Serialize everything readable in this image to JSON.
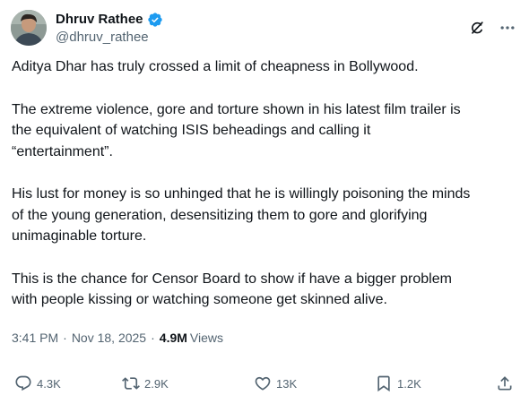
{
  "author": {
    "display_name": "Dhruv Rathee",
    "handle": "@dhruv_rathee",
    "verified": true,
    "avatar_icon": "profile-photo"
  },
  "header_icons": [
    "grok-icon",
    "more-icon"
  ],
  "tweet": {
    "paragraphs": [
      "Aditya Dhar has truly crossed a limit of cheapness in Bollywood.",
      "The extreme violence, gore and torture  shown in his latest film trailer is\nthe equivalent of watching ISIS beheadings and calling it\n“entertainment”.",
      "His lust for money is so unhinged that he is willingly poisoning the minds\nof the young generation, desensitizing them to gore and glorifying\nunimaginable torture.",
      "This is the chance for Censor Board to show if have a bigger problem\nwith people kissing or watching someone get skinned alive."
    ]
  },
  "meta": {
    "time": "3:41 PM",
    "dot1": "·",
    "date": "Nov 18, 2025",
    "dot2": "·",
    "views_count": "4.9M",
    "views_label": "Views"
  },
  "actions": {
    "replies": "4.3K",
    "reposts": "2.9K",
    "likes": "13K",
    "bookmarks": "1.2K"
  },
  "colors": {
    "text_primary": "#0f1419",
    "text_secondary": "#536471",
    "verified_blue": "#1d9bf0"
  }
}
